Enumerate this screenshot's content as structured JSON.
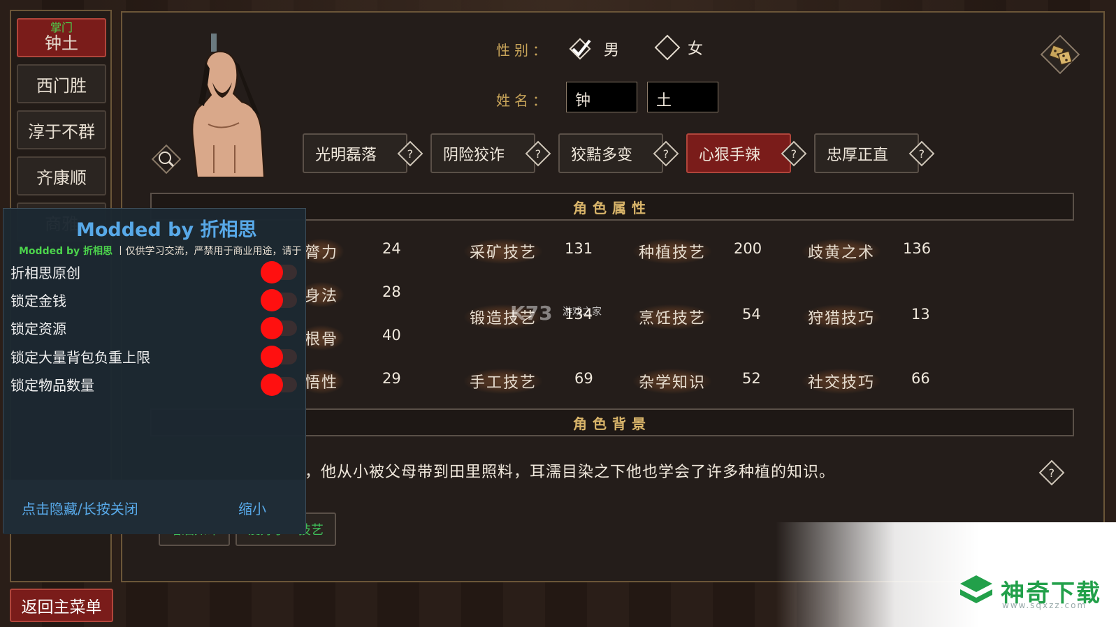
{
  "roster": {
    "active_tag": "掌门",
    "items": [
      "钟土",
      "西门胜",
      "淳于不群",
      "齐康顺",
      "商雅"
    ]
  },
  "main_menu_label": "返回主菜单",
  "gender": {
    "label": "性别：",
    "male": "男",
    "female": "女",
    "selected": "男"
  },
  "name": {
    "label": "姓名：",
    "surname": "钟",
    "given": "土"
  },
  "traits": [
    {
      "label": "光明磊落",
      "active": false
    },
    {
      "label": "阴险狡诈",
      "active": false
    },
    {
      "label": "狡黠多变",
      "active": false
    },
    {
      "label": "心狠手辣",
      "active": true
    },
    {
      "label": "忠厚正直",
      "active": false
    }
  ],
  "sections": {
    "attributes": "角色属性",
    "background": "角色背景"
  },
  "base_attrs": [
    {
      "name": "膂力",
      "value": "24"
    },
    {
      "name": "身法",
      "value": "28"
    },
    {
      "name": "根骨",
      "value": "40"
    },
    {
      "name": "悟性",
      "value": "29"
    }
  ],
  "skills": [
    {
      "name": "采矿技艺",
      "value": "131"
    },
    {
      "name": "种植技艺",
      "value": "200"
    },
    {
      "name": "歧黄之术",
      "value": "136"
    },
    {
      "name": "锻造技艺",
      "value": "134"
    },
    {
      "name": "烹饪技艺",
      "value": "54"
    },
    {
      "name": "狩猎技巧",
      "value": "13"
    },
    {
      "name": "手工技艺",
      "value": "69"
    },
    {
      "name": "杂学知识",
      "value": "52"
    },
    {
      "name": "社交技巧",
      "value": "66"
    }
  ],
  "bio": "，他从小被父母带到田里照料，耳濡目染之下他也学会了许多种植的知识。",
  "hobbies": [
    "嗜酒如命",
    "爱好手工技艺"
  ],
  "mod": {
    "title": "Modded by 折相思",
    "sub_green": "Modded by 折相思",
    "sub_text": "丨仅供学习交流，严禁用于商业用途，请于",
    "options": [
      {
        "label": "折相思原创",
        "on": true
      },
      {
        "label": "锁定金钱",
        "on": true
      },
      {
        "label": "锁定资源",
        "on": true
      },
      {
        "label": "锁定大量背包负重上限",
        "on": true
      },
      {
        "label": "锁定物品数量",
        "on": true
      }
    ],
    "hide_label": "点击隐藏/长按关闭",
    "shrink_label": "缩小"
  },
  "watermark": {
    "k73": "K73",
    "k73_sub": "游戏之家",
    "brand": "神奇下载",
    "url": "www.sqxzz.com"
  }
}
